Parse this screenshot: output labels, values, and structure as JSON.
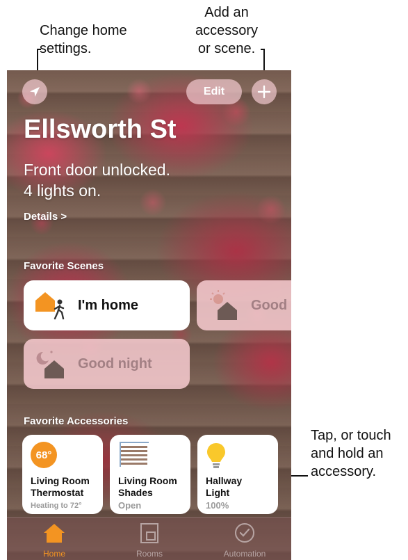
{
  "annotations": {
    "top_left": [
      "Change home",
      "settings."
    ],
    "top_right": [
      "Add an",
      "accessory",
      "or scene."
    ],
    "side": [
      "Tap, or touch",
      "and hold an",
      "accessory."
    ]
  },
  "header": {
    "location_icon": "location-arrow-icon",
    "edit_label": "Edit",
    "add_icon": "plus-icon"
  },
  "home": {
    "title": "Ellsworth St",
    "status_line1": "Front door unlocked.",
    "status_line2": "4 lights on.",
    "details_label": "Details >"
  },
  "favorite_scenes": {
    "label": "Favorite Scenes",
    "items": [
      {
        "label": "I'm home",
        "icon": "home-arrive-icon",
        "active": true
      },
      {
        "label": "Good m",
        "icon": "good-morning-icon",
        "active": false
      },
      {
        "label": "Good night",
        "icon": "good-night-icon",
        "active": false
      }
    ]
  },
  "favorite_accessories": {
    "label": "Favorite Accessories",
    "items": [
      {
        "name_line1": "Living Room",
        "name_line2": "Thermostat",
        "status": "Heating to 72°",
        "badge": "68°",
        "icon": "thermostat-icon"
      },
      {
        "name_line1": "Living Room",
        "name_line2": "Shades",
        "status": "Open",
        "icon": "shades-icon"
      },
      {
        "name_line1": "Hallway",
        "name_line2": "Light",
        "status": "100%",
        "icon": "lightbulb-icon"
      }
    ]
  },
  "tabbar": {
    "items": [
      {
        "label": "Home",
        "icon": "house-icon",
        "selected": true
      },
      {
        "label": "Rooms",
        "icon": "rooms-icon",
        "selected": false
      },
      {
        "label": "Automation",
        "icon": "clock-icon",
        "selected": false
      }
    ]
  },
  "colors": {
    "accent_orange": "#f39422",
    "light_yellow": "#f9c82b",
    "house_brown": "#6d5a55"
  }
}
